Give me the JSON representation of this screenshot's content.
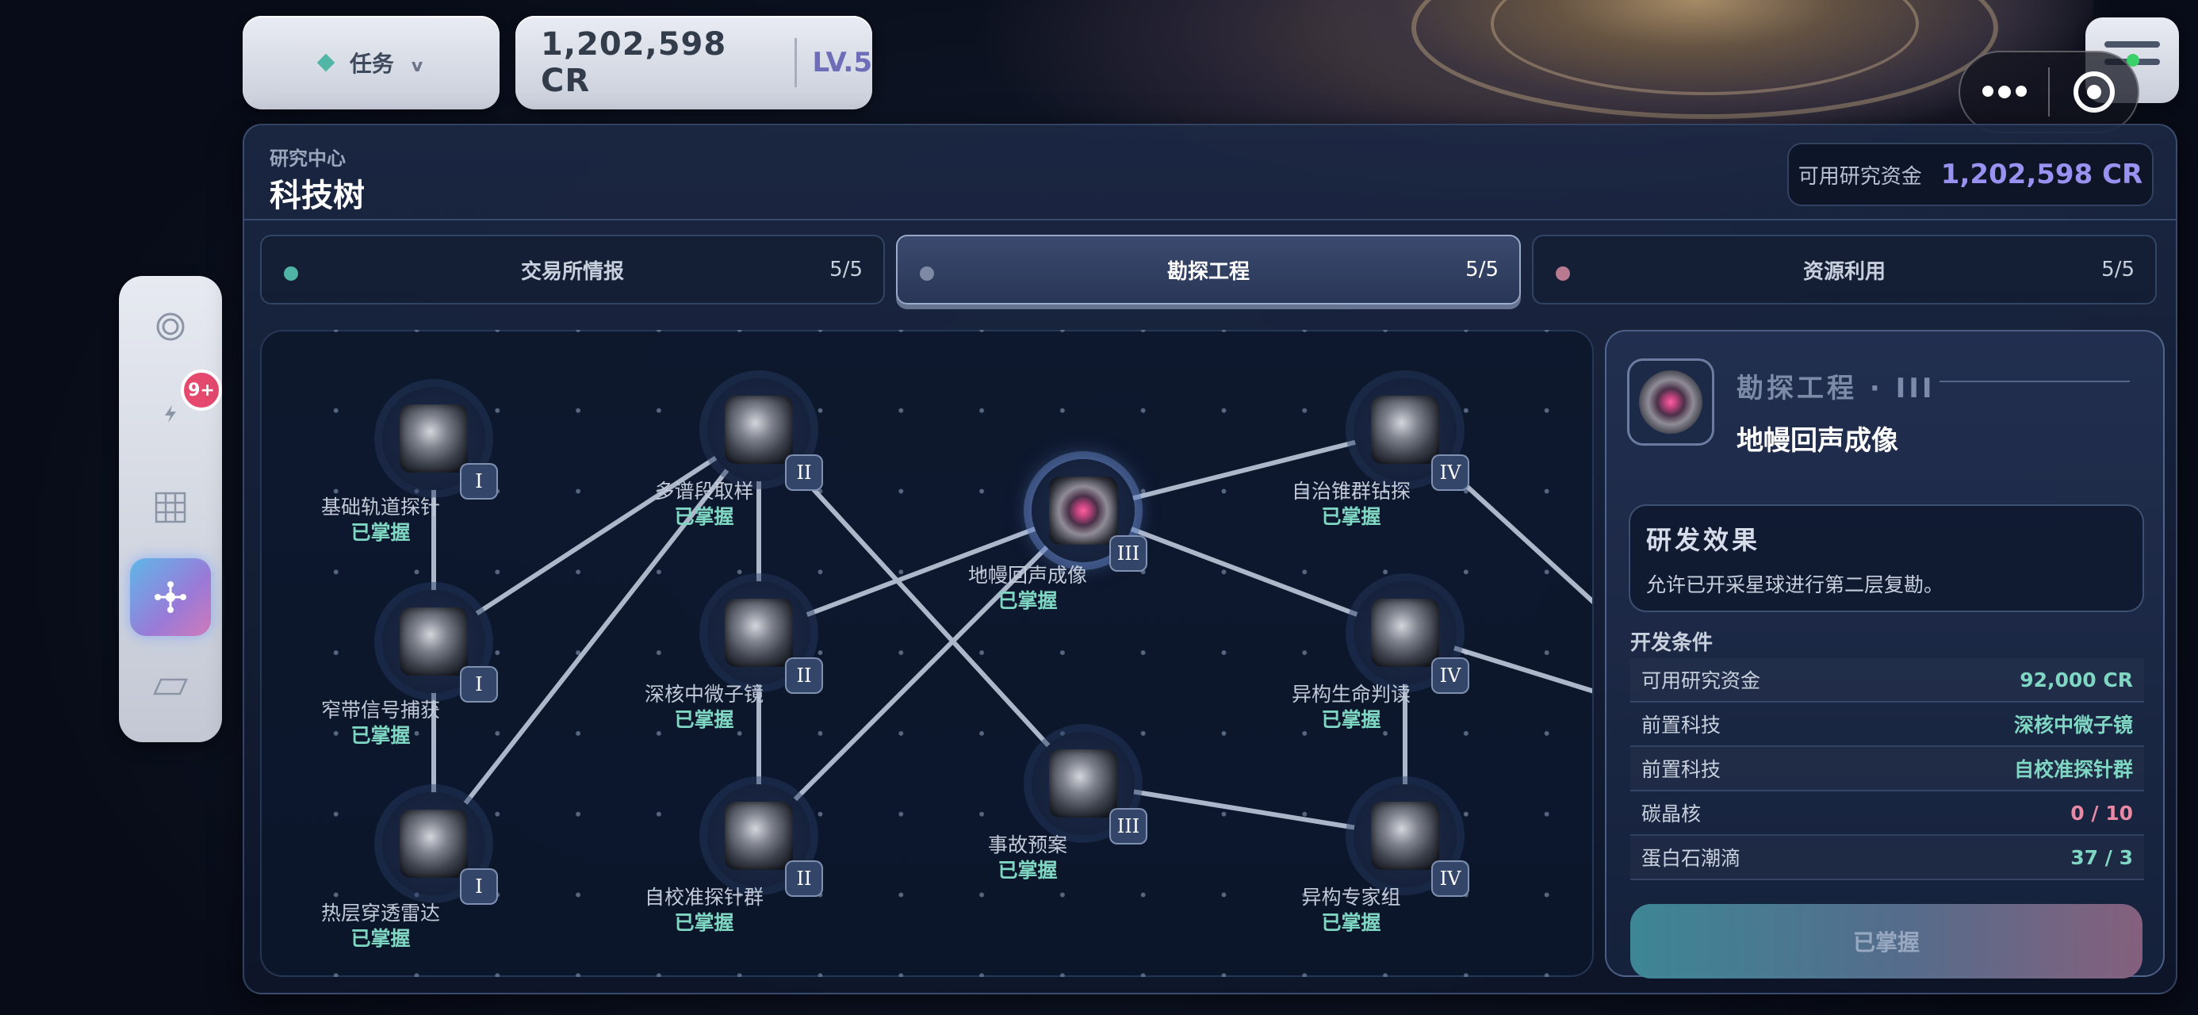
{
  "topbar": {
    "mission_label": "任务",
    "mission_chevron": "v",
    "credits": "1,202,598 CR",
    "level": "LV.5"
  },
  "sidebar": {
    "badge": "9+",
    "items": [
      {
        "icon": "target-icon"
      },
      {
        "icon": "bolt-icon"
      },
      {
        "icon": "grid-icon"
      },
      {
        "icon": "network-icon",
        "active": true
      },
      {
        "icon": "card-icon"
      }
    ]
  },
  "panel": {
    "subtitle": "研究中心",
    "title": "科技树",
    "fund_label": "可用研究资金",
    "fund_value": "1,202,598 CR"
  },
  "tabs": [
    {
      "label": "交易所情报",
      "count": "5/5",
      "color": "#4fb3a6"
    },
    {
      "label": "勘探工程",
      "count": "5/5",
      "color": "#7e8aa3",
      "active": true
    },
    {
      "label": "资源利用",
      "count": "5/5",
      "color": "#b87a8e"
    }
  ],
  "nodes": [
    {
      "id": "n1",
      "name": "基础轨道探针",
      "status": "已掌握",
      "tier": "I"
    },
    {
      "id": "n2",
      "name": "窄带信号捕获",
      "status": "已掌握",
      "tier": "I"
    },
    {
      "id": "n3",
      "name": "热层穿透雷达",
      "status": "已掌握",
      "tier": "I"
    },
    {
      "id": "n4",
      "name": "多谱段取样",
      "status": "已掌握",
      "tier": "II"
    },
    {
      "id": "n5",
      "name": "深核中微子镜",
      "status": "已掌握",
      "tier": "II"
    },
    {
      "id": "n6",
      "name": "自校准探针群",
      "status": "已掌握",
      "tier": "II"
    },
    {
      "id": "n7",
      "name": "地幔回声成像",
      "status": "已掌握",
      "tier": "III"
    },
    {
      "id": "n8",
      "name": "事故预案",
      "status": "已掌握",
      "tier": "III"
    },
    {
      "id": "n9",
      "name": "自治锥群钻探",
      "status": "已掌握",
      "tier": "IV"
    },
    {
      "id": "n10",
      "name": "异构生命判读",
      "status": "已掌握",
      "tier": "IV"
    },
    {
      "id": "n11",
      "name": "异构专家组",
      "status": "已掌握",
      "tier": "IV"
    }
  ],
  "detail": {
    "branch": "勘探工程 · III",
    "name": "地幔回声成像",
    "effect_title": "研发效果",
    "effect_text": "允许已开采星球进行第二层复勘。",
    "req_title": "开发条件",
    "requirements": [
      {
        "label": "可用研究资金",
        "value": "92,000 CR",
        "color": "#7fd6c2"
      },
      {
        "label": "前置科技",
        "value": "深核中微子镜",
        "color": "#7fd6c2"
      },
      {
        "label": "前置科技",
        "value": "自校准探针群",
        "color": "#7fd6c2"
      },
      {
        "label": "碳晶核",
        "value": "0 / 10",
        "color": "#e88aa6"
      },
      {
        "label": "蛋白石潮滴",
        "value": "37 / 3",
        "color": "#7fd6c2"
      }
    ],
    "button": "已掌握"
  }
}
